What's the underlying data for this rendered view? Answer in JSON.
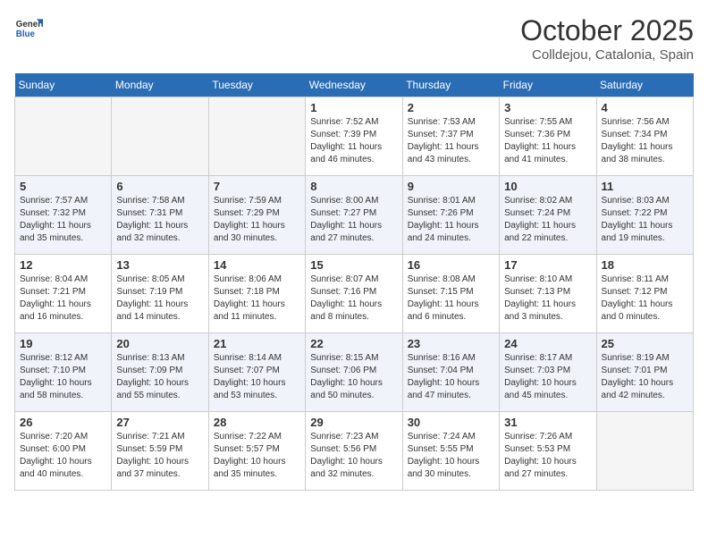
{
  "header": {
    "logo_line1": "General",
    "logo_line2": "Blue",
    "month": "October 2025",
    "location": "Colldejou, Catalonia, Spain"
  },
  "days_of_week": [
    "Sunday",
    "Monday",
    "Tuesday",
    "Wednesday",
    "Thursday",
    "Friday",
    "Saturday"
  ],
  "weeks": [
    [
      {
        "day": "",
        "empty": true
      },
      {
        "day": "",
        "empty": true
      },
      {
        "day": "",
        "empty": true
      },
      {
        "day": "1",
        "sunrise": "7:52 AM",
        "sunset": "7:39 PM",
        "daylight": "11 hours and 46 minutes."
      },
      {
        "day": "2",
        "sunrise": "7:53 AM",
        "sunset": "7:37 PM",
        "daylight": "11 hours and 43 minutes."
      },
      {
        "day": "3",
        "sunrise": "7:55 AM",
        "sunset": "7:36 PM",
        "daylight": "11 hours and 41 minutes."
      },
      {
        "day": "4",
        "sunrise": "7:56 AM",
        "sunset": "7:34 PM",
        "daylight": "11 hours and 38 minutes."
      }
    ],
    [
      {
        "day": "5",
        "sunrise": "7:57 AM",
        "sunset": "7:32 PM",
        "daylight": "11 hours and 35 minutes."
      },
      {
        "day": "6",
        "sunrise": "7:58 AM",
        "sunset": "7:31 PM",
        "daylight": "11 hours and 32 minutes."
      },
      {
        "day": "7",
        "sunrise": "7:59 AM",
        "sunset": "7:29 PM",
        "daylight": "11 hours and 30 minutes."
      },
      {
        "day": "8",
        "sunrise": "8:00 AM",
        "sunset": "7:27 PM",
        "daylight": "11 hours and 27 minutes."
      },
      {
        "day": "9",
        "sunrise": "8:01 AM",
        "sunset": "7:26 PM",
        "daylight": "11 hours and 24 minutes."
      },
      {
        "day": "10",
        "sunrise": "8:02 AM",
        "sunset": "7:24 PM",
        "daylight": "11 hours and 22 minutes."
      },
      {
        "day": "11",
        "sunrise": "8:03 AM",
        "sunset": "7:22 PM",
        "daylight": "11 hours and 19 minutes."
      }
    ],
    [
      {
        "day": "12",
        "sunrise": "8:04 AM",
        "sunset": "7:21 PM",
        "daylight": "11 hours and 16 minutes."
      },
      {
        "day": "13",
        "sunrise": "8:05 AM",
        "sunset": "7:19 PM",
        "daylight": "11 hours and 14 minutes."
      },
      {
        "day": "14",
        "sunrise": "8:06 AM",
        "sunset": "7:18 PM",
        "daylight": "11 hours and 11 minutes."
      },
      {
        "day": "15",
        "sunrise": "8:07 AM",
        "sunset": "7:16 PM",
        "daylight": "11 hours and 8 minutes."
      },
      {
        "day": "16",
        "sunrise": "8:08 AM",
        "sunset": "7:15 PM",
        "daylight": "11 hours and 6 minutes."
      },
      {
        "day": "17",
        "sunrise": "8:10 AM",
        "sunset": "7:13 PM",
        "daylight": "11 hours and 3 minutes."
      },
      {
        "day": "18",
        "sunrise": "8:11 AM",
        "sunset": "7:12 PM",
        "daylight": "11 hours and 0 minutes."
      }
    ],
    [
      {
        "day": "19",
        "sunrise": "8:12 AM",
        "sunset": "7:10 PM",
        "daylight": "10 hours and 58 minutes."
      },
      {
        "day": "20",
        "sunrise": "8:13 AM",
        "sunset": "7:09 PM",
        "daylight": "10 hours and 55 minutes."
      },
      {
        "day": "21",
        "sunrise": "8:14 AM",
        "sunset": "7:07 PM",
        "daylight": "10 hours and 53 minutes."
      },
      {
        "day": "22",
        "sunrise": "8:15 AM",
        "sunset": "7:06 PM",
        "daylight": "10 hours and 50 minutes."
      },
      {
        "day": "23",
        "sunrise": "8:16 AM",
        "sunset": "7:04 PM",
        "daylight": "10 hours and 47 minutes."
      },
      {
        "day": "24",
        "sunrise": "8:17 AM",
        "sunset": "7:03 PM",
        "daylight": "10 hours and 45 minutes."
      },
      {
        "day": "25",
        "sunrise": "8:19 AM",
        "sunset": "7:01 PM",
        "daylight": "10 hours and 42 minutes."
      }
    ],
    [
      {
        "day": "26",
        "sunrise": "7:20 AM",
        "sunset": "6:00 PM",
        "daylight": "10 hours and 40 minutes."
      },
      {
        "day": "27",
        "sunrise": "7:21 AM",
        "sunset": "5:59 PM",
        "daylight": "10 hours and 37 minutes."
      },
      {
        "day": "28",
        "sunrise": "7:22 AM",
        "sunset": "5:57 PM",
        "daylight": "10 hours and 35 minutes."
      },
      {
        "day": "29",
        "sunrise": "7:23 AM",
        "sunset": "5:56 PM",
        "daylight": "10 hours and 32 minutes."
      },
      {
        "day": "30",
        "sunrise": "7:24 AM",
        "sunset": "5:55 PM",
        "daylight": "10 hours and 30 minutes."
      },
      {
        "day": "31",
        "sunrise": "7:26 AM",
        "sunset": "5:53 PM",
        "daylight": "10 hours and 27 minutes."
      },
      {
        "day": "",
        "empty": true
      }
    ]
  ],
  "labels": {
    "sunrise": "Sunrise:",
    "sunset": "Sunset:",
    "daylight": "Daylight:"
  }
}
